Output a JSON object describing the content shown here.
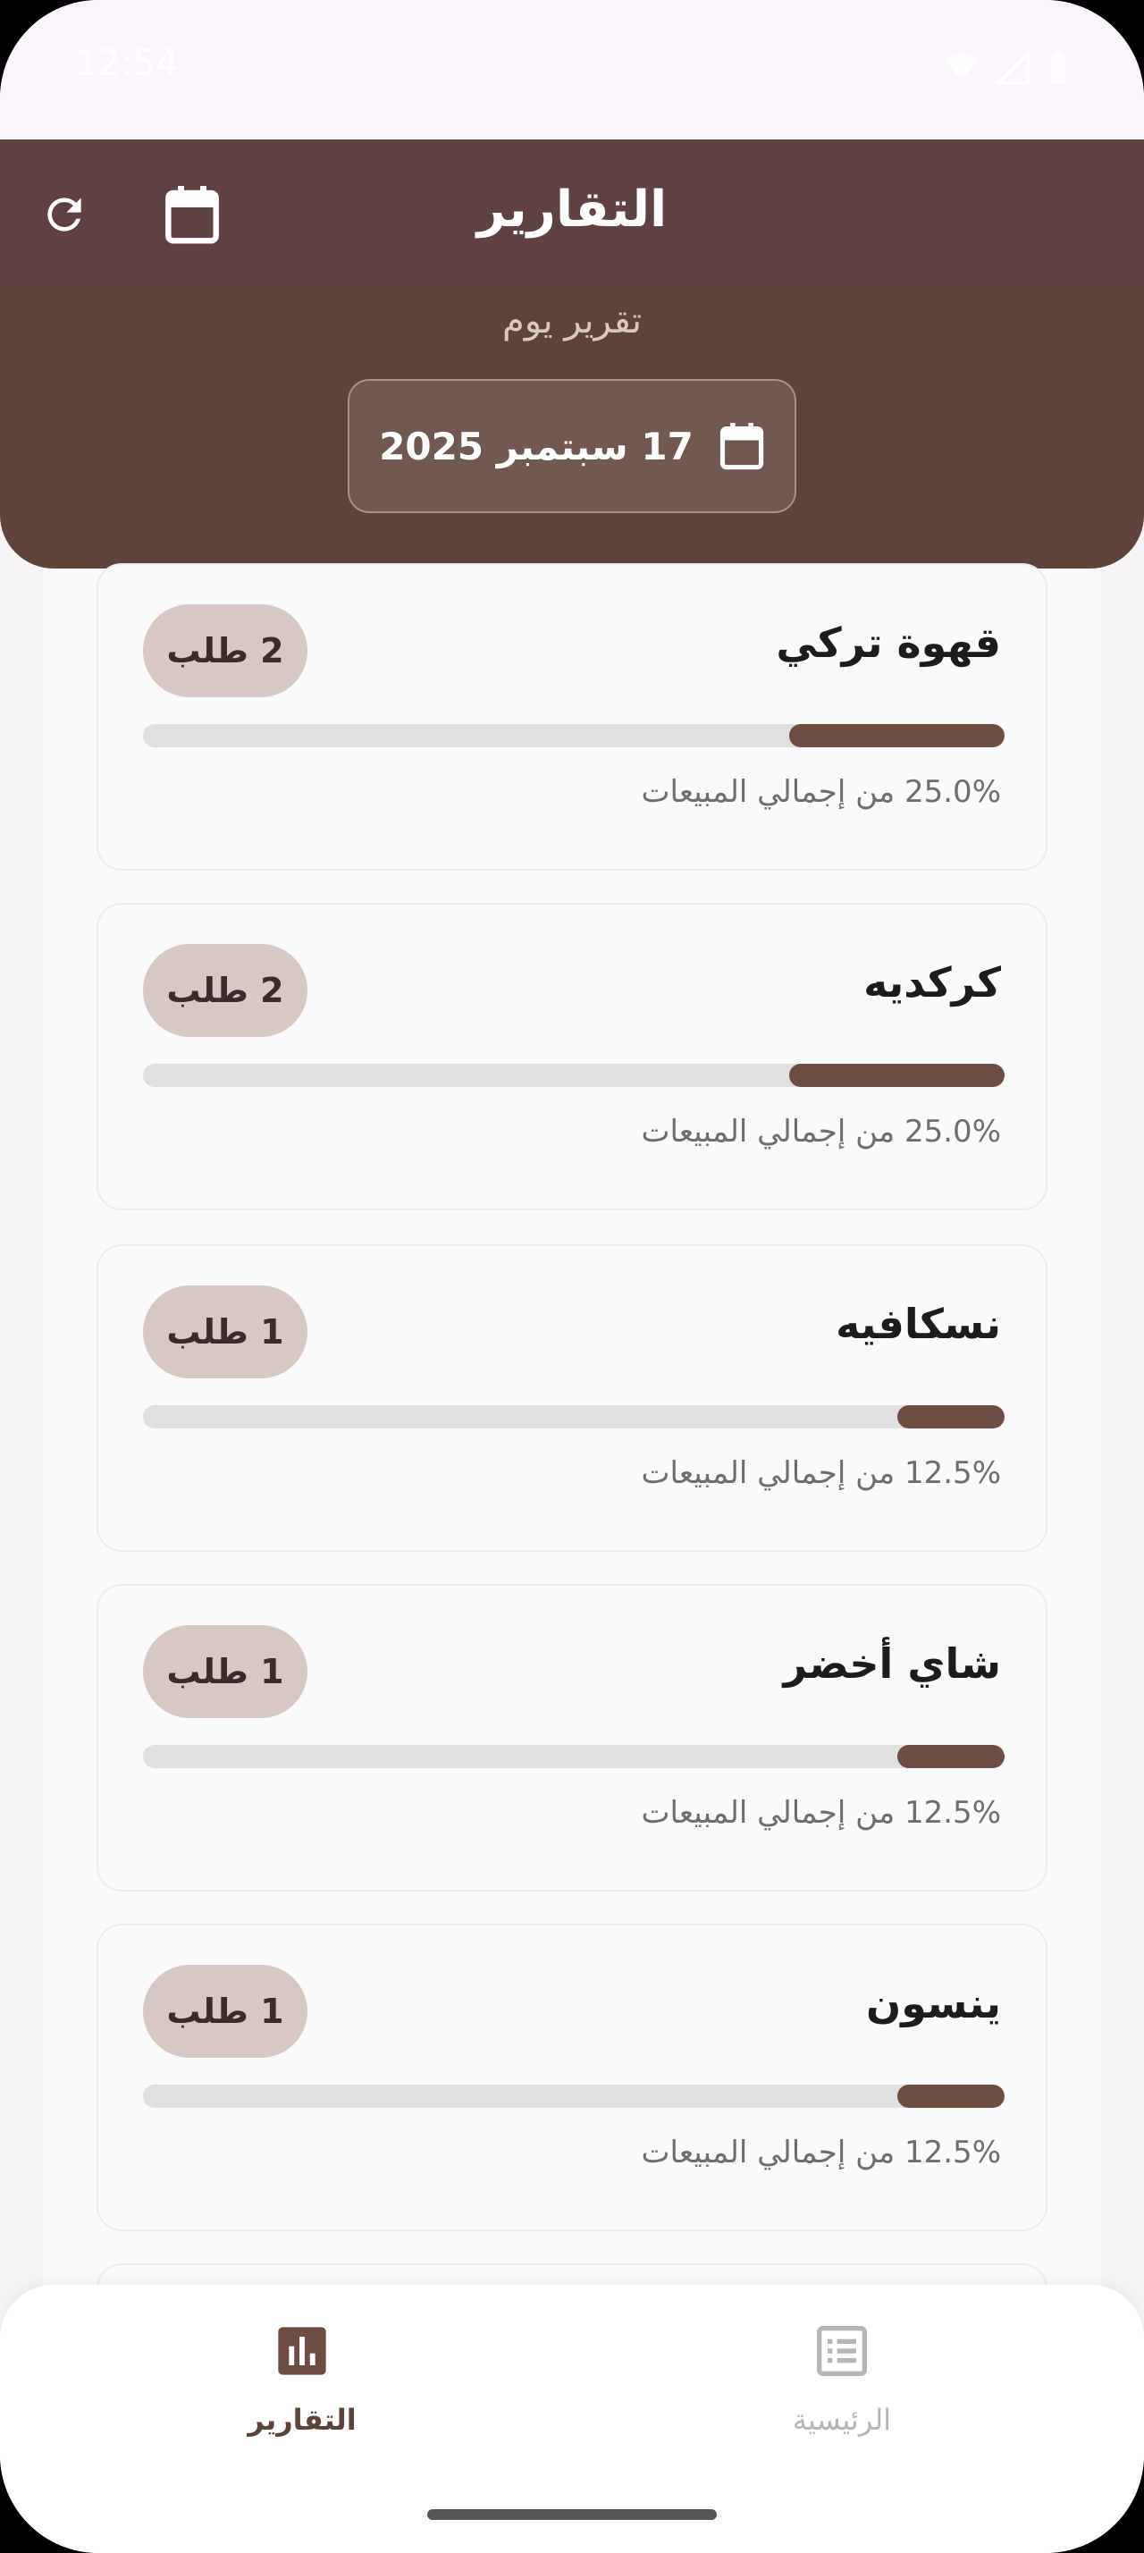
{
  "status_bar": {
    "time": "12:54"
  },
  "app_bar": {
    "title": "التقارير",
    "refresh_icon": "refresh-icon",
    "calendar_icon": "calendar-icon"
  },
  "header": {
    "subtitle": "تقرير يوم",
    "date_label": "17 سبتمبر 2025",
    "date_icon": "calendar-icon"
  },
  "items": [
    {
      "name": "قهوة تركي",
      "count": "2 طلب",
      "percent_text": "25.0% من إجمالي المبيعات",
      "share": 0.25
    },
    {
      "name": "كركديه",
      "count": "2 طلب",
      "percent_text": "25.0% من إجمالي المبيعات",
      "share": 0.25
    },
    {
      "name": "نسكافيه",
      "count": "1 طلب",
      "percent_text": "12.5% من إجمالي المبيعات",
      "share": 0.125
    },
    {
      "name": "شاي أخضر",
      "count": "1 طلب",
      "percent_text": "12.5% من إجمالي المبيعات",
      "share": 0.125
    },
    {
      "name": "ينسون",
      "count": "1 طلب",
      "percent_text": "12.5% من إجمالي المبيعات",
      "share": 0.125
    }
  ],
  "bottom_nav": {
    "reports": {
      "label": "التقارير",
      "icon": "bar-chart-icon",
      "active": true
    },
    "home": {
      "label": "الرئيسية",
      "icon": "receipt-list-icon",
      "active": false
    }
  },
  "colors": {
    "primary": "#5e4140",
    "accent": "#6d4c41",
    "pill": "#d8c8c4",
    "inactive": "#b7b3b8"
  }
}
